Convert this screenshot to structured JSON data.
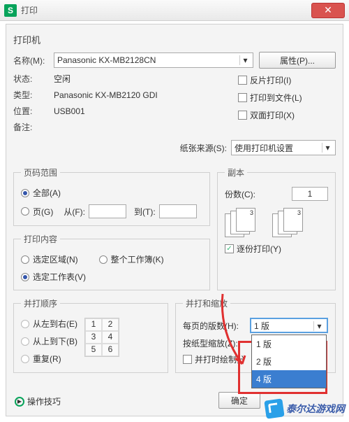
{
  "window": {
    "title": "打印"
  },
  "printer": {
    "section": "打印机",
    "name_label": "名称(M):",
    "name_value": "Panasonic KX-MB2128CN",
    "props_btn": "属性(P)...",
    "status_label": "状态:",
    "status_value": "空闲",
    "type_label": "类型:",
    "type_value": "Panasonic KX-MB2120 GDI",
    "where_label": "位置:",
    "where_value": "USB001",
    "comment_label": "备注:",
    "reverse_label": "反片打印(I)",
    "tofile_label": "打印到文件(L)",
    "duplex_label": "双面打印(X)",
    "source_label": "纸张来源(S):",
    "source_value": "使用打印机设置"
  },
  "range": {
    "legend": "页码范围",
    "all": "全部(A)",
    "page": "页(G)",
    "from": "从(F):",
    "to": "到(T):"
  },
  "copies": {
    "legend": "副本",
    "count_label": "份数(C):",
    "count_value": "1",
    "collate": "逐份打印(Y)"
  },
  "content": {
    "legend": "打印内容",
    "selection": "选定区域(N)",
    "workbook": "整个工作簿(K)",
    "sheets": "选定工作表(V)"
  },
  "order": {
    "legend": "并打顺序",
    "lr": "从左到右(E)",
    "tb": "从上到下(B)",
    "repeat": "重复(R)"
  },
  "scale": {
    "legend": "并打和缩放",
    "perpage_label": "每页的版数(H):",
    "perpage_value": "1 版",
    "bysize_label": "按纸型缩放(Z):",
    "opts": [
      "1 版",
      "2 版",
      "4 版"
    ],
    "border": "并打时绘制分"
  },
  "footer": {
    "tips": "操作技巧",
    "ok": "确定"
  },
  "watermark": "泰尔达游戏网"
}
